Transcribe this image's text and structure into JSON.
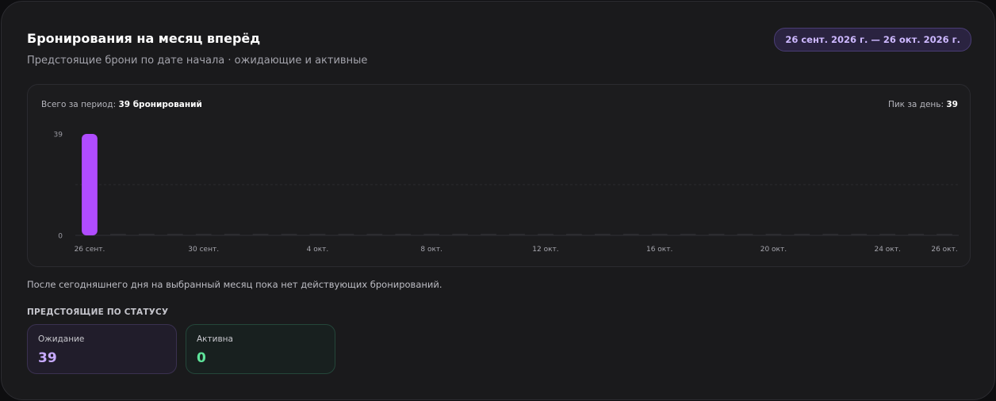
{
  "header": {
    "title": "Бронирования на месяц вперёд",
    "subtitle": "Предстоящие брони по дате начала · ожидающие и активные",
    "date_range": "26 сент. 2026 г. — 26 окт. 2026 г."
  },
  "summary": {
    "total_prefix": "Всего за период:",
    "total_value": "39 бронирований",
    "peak_prefix": "Пик за день:",
    "peak_value": "39"
  },
  "colors": {
    "accent_bar": "#b04cff",
    "empty_bar": "#2c2c30",
    "pending_value": "#c7aaff",
    "active_value": "#5ee39a"
  },
  "chart_data": {
    "type": "bar",
    "categories": [
      "26 сент.",
      "27 сент.",
      "28 сент.",
      "29 сент.",
      "30 сент.",
      "1 окт.",
      "2 окт.",
      "3 окт.",
      "4 окт.",
      "5 окт.",
      "6 окт.",
      "7 окт.",
      "8 окт.",
      "9 окт.",
      "10 окт.",
      "11 окт.",
      "12 окт.",
      "13 окт.",
      "14 окт.",
      "15 окт.",
      "16 окт.",
      "17 окт.",
      "18 окт.",
      "19 окт.",
      "20 окт.",
      "21 окт.",
      "22 окт.",
      "23 окт.",
      "24 окт.",
      "25 окт.",
      "26 окт."
    ],
    "values": [
      39,
      0,
      0,
      0,
      0,
      0,
      0,
      0,
      0,
      0,
      0,
      0,
      0,
      0,
      0,
      0,
      0,
      0,
      0,
      0,
      0,
      0,
      0,
      0,
      0,
      0,
      0,
      0,
      0,
      0,
      0
    ],
    "xtick_labels": [
      {
        "index": 0,
        "label": "26 сент."
      },
      {
        "index": 4,
        "label": "30 сент."
      },
      {
        "index": 8,
        "label": "4 окт."
      },
      {
        "index": 12,
        "label": "8 окт."
      },
      {
        "index": 16,
        "label": "12 окт."
      },
      {
        "index": 20,
        "label": "16 окт."
      },
      {
        "index": 24,
        "label": "20 окт."
      },
      {
        "index": 28,
        "label": "24 окт."
      },
      {
        "index": 30,
        "label": "26 окт."
      }
    ],
    "yticks": [
      0,
      39
    ],
    "ylim": [
      0,
      39
    ],
    "title": "",
    "xlabel": "",
    "ylabel": "",
    "grid": true
  },
  "empty_note": "После сегодняшнего дня на выбранный месяц пока нет действующих бронирований.",
  "status_section": {
    "heading": "ПРЕДСТОЯЩИЕ ПО СТАТУСУ",
    "pending": {
      "label": "Ожидание",
      "value": "39"
    },
    "active": {
      "label": "Активна",
      "value": "0"
    }
  }
}
